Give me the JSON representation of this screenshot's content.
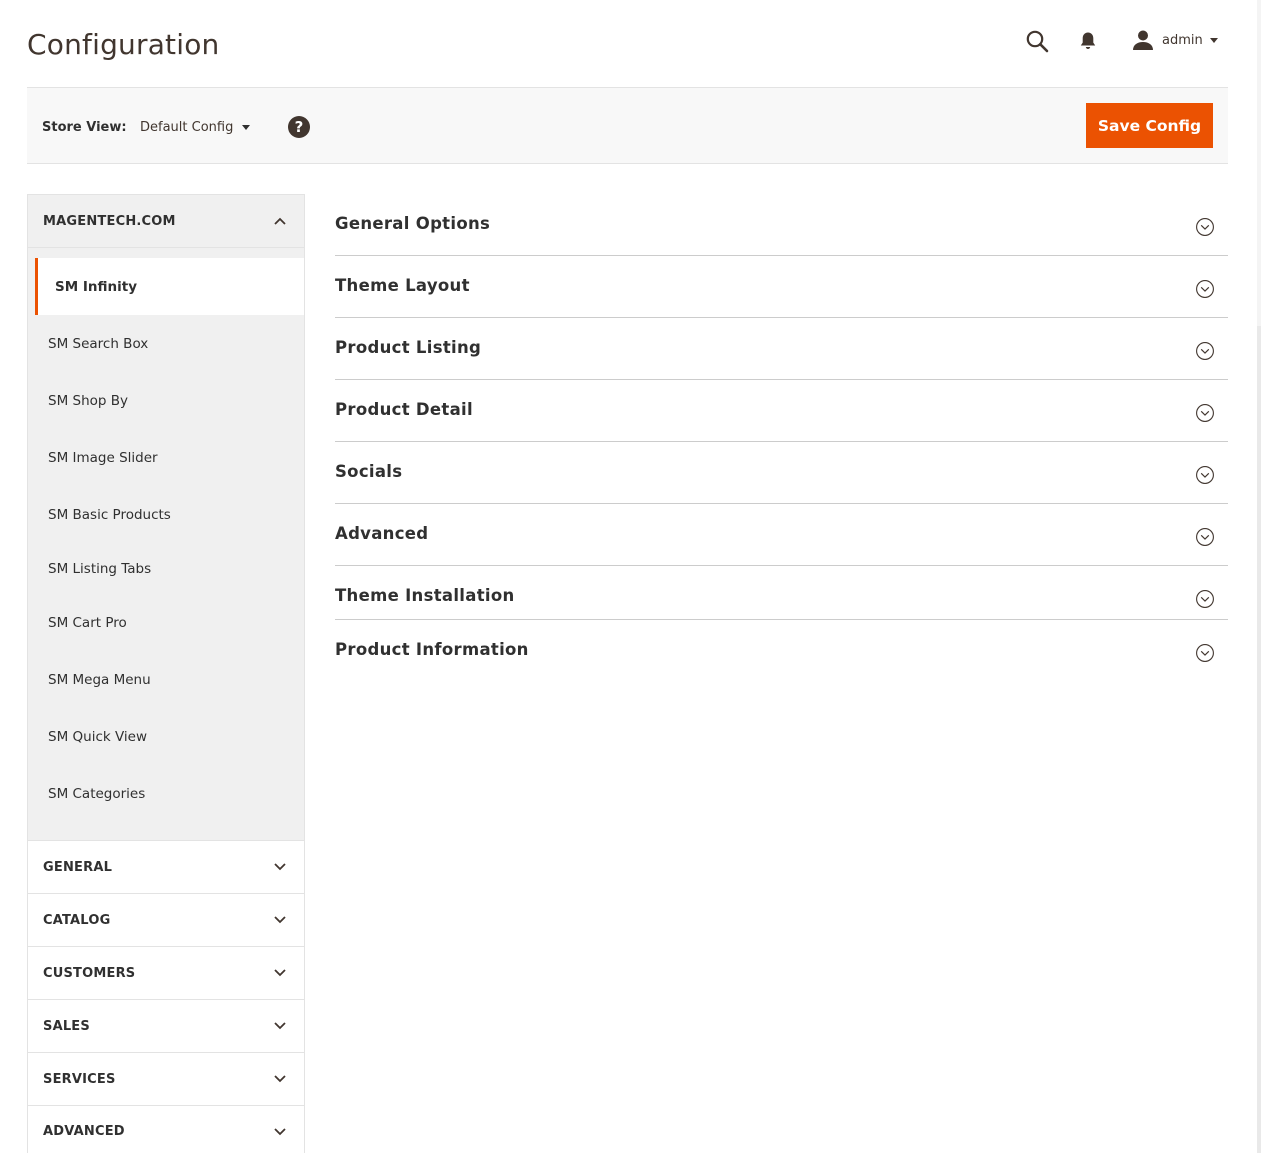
{
  "page": {
    "title": "Configuration"
  },
  "header": {
    "user_name": "admin"
  },
  "store_bar": {
    "label": "Store View:",
    "value": "Default Config",
    "help_symbol": "?",
    "save_label": "Save Config"
  },
  "colors": {
    "accent": "#eb5202",
    "text": "#303030",
    "sidebar_bg": "#f0f0f0"
  },
  "sidebar": {
    "open_group": {
      "label": "MAGENTECH.COM",
      "items": [
        {
          "label": "SM Infinity",
          "active": true
        },
        {
          "label": "SM Search Box"
        },
        {
          "label": "SM Shop By"
        },
        {
          "label": "SM Image Slider"
        },
        {
          "label": "SM Basic Products"
        },
        {
          "label": "SM Listing Tabs"
        },
        {
          "label": "SM Cart Pro"
        },
        {
          "label": "SM Mega Menu"
        },
        {
          "label": "SM Quick View"
        },
        {
          "label": "SM Categories"
        }
      ]
    },
    "groups": [
      {
        "label": "GENERAL"
      },
      {
        "label": "CATALOG"
      },
      {
        "label": "CUSTOMERS"
      },
      {
        "label": "SALES"
      },
      {
        "label": "SERVICES"
      },
      {
        "label": "ADVANCED"
      }
    ]
  },
  "sections": [
    {
      "title": "General Options"
    },
    {
      "title": "Theme Layout"
    },
    {
      "title": "Product Listing"
    },
    {
      "title": "Product Detail"
    },
    {
      "title": "Socials"
    },
    {
      "title": "Advanced"
    },
    {
      "title": "Theme Installation"
    },
    {
      "title": "Product Information"
    }
  ]
}
